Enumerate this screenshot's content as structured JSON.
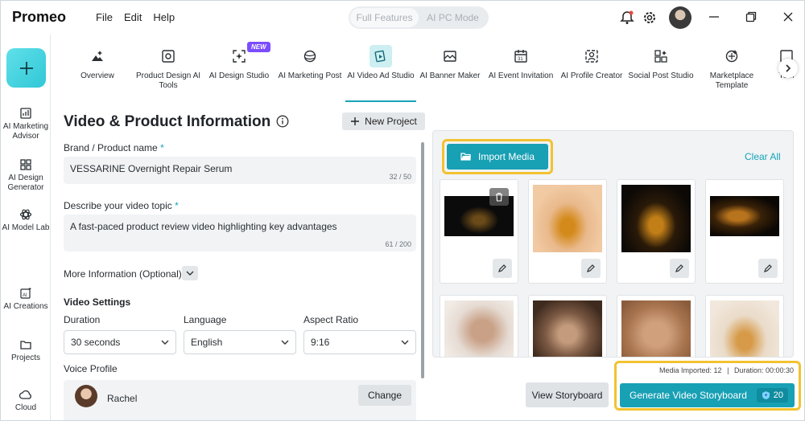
{
  "app": {
    "name": "Promeo",
    "menu": [
      "File",
      "Edit",
      "Help"
    ],
    "modes": [
      "Full Features",
      "AI PC Mode"
    ]
  },
  "sidebar": {
    "items": [
      {
        "label": "AI Marketing Advisor",
        "icon": "advisor-icon"
      },
      {
        "label": "AI Design Generator",
        "icon": "grid-icon"
      },
      {
        "label": "AI Model Lab",
        "icon": "atom-icon"
      },
      {
        "label": "AI Creations",
        "icon": "ai-creations-icon"
      },
      {
        "label": "Projects",
        "icon": "folder-icon"
      },
      {
        "label": "Cloud",
        "icon": "cloud-icon"
      }
    ]
  },
  "toolnav": {
    "badge": "NEW",
    "items": [
      {
        "label": "Overview",
        "icon": "overview-icon"
      },
      {
        "label": "Product Design AI Tools",
        "icon": "product-design-icon"
      },
      {
        "label": "AI Design Studio",
        "icon": "design-studio-icon"
      },
      {
        "label": "AI Marketing Post",
        "icon": "marketing-post-icon"
      },
      {
        "label": "AI Video Ad Studio",
        "icon": "video-ad-icon"
      },
      {
        "label": "AI Banner Maker",
        "icon": "banner-icon"
      },
      {
        "label": "AI Event Invitation",
        "icon": "calendar-icon"
      },
      {
        "label": "AI Profile Creator",
        "icon": "profile-icon"
      },
      {
        "label": "Social Post Studio",
        "icon": "social-post-icon"
      },
      {
        "label": "Marketplace Template",
        "icon": "marketplace-icon"
      },
      {
        "label": "Tem",
        "icon": "template-icon"
      }
    ]
  },
  "form": {
    "title": "Video & Product Information",
    "new_project": "New Project",
    "brand_label": "Brand / Product name",
    "brand_value": "VESSARINE Overnight Repair Serum",
    "brand_count": "32 / 50",
    "topic_label": "Describe your video topic",
    "topic_value": "A fast-paced product review video highlighting key advantages",
    "topic_count": "61 / 200",
    "required_mark": "*",
    "more_info": "More Information (Optional)",
    "video_settings": "Video Settings",
    "duration_label": "Duration",
    "duration_value": "30 seconds",
    "language_label": "Language",
    "language_value": "English",
    "aspect_label": "Aspect Ratio",
    "aspect_value": "9:16",
    "voice_label": "Voice Profile",
    "voice_name": "Rachel",
    "change": "Change"
  },
  "media": {
    "import_label": "Import Media",
    "clear_all": "Clear All",
    "stats_imported": "Media Imported: 12",
    "stats_duration": "Duration: 00:00:30",
    "view_storyboard": "View Storyboard",
    "generate_label": "Generate Video Storyboard",
    "generate_credits": "20"
  },
  "colors": {
    "accent": "#18a0b4",
    "highlight": "#f2c230",
    "new_badge": "#7b4dff"
  }
}
